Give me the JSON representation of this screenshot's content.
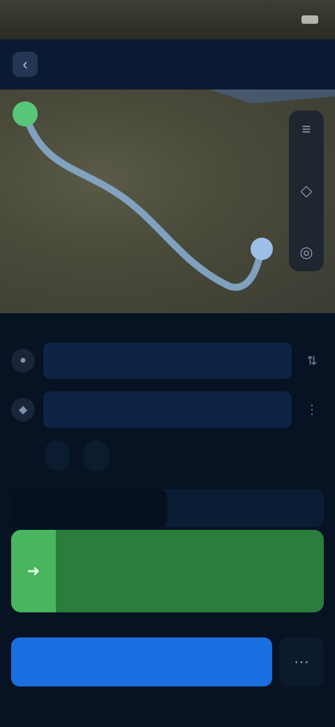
{
  "status_bar": {
    "time": "",
    "battery_icon": "battery-icon"
  },
  "header": {
    "title": "",
    "back_icon": "back-arrow-icon"
  },
  "map": {
    "controls": [
      "layers-icon",
      "compass-icon",
      "locate-icon"
    ]
  },
  "route_inputs": {
    "origin": {
      "value": "",
      "icon": "origin-dot-icon"
    },
    "destination": {
      "value": "",
      "icon": "destination-pin-icon"
    },
    "swap_icon": "swap-icon"
  },
  "options": {
    "chips": [
      "",
      ""
    ]
  },
  "mode_toggle": {
    "options": [
      "",
      ""
    ],
    "active_index": 0
  },
  "route_card": {
    "time": "",
    "details": "",
    "icon": "route-icon"
  },
  "actions": {
    "start_label": "",
    "more_icon": "more-icon"
  },
  "colors": {
    "accent": "#1a6fe0",
    "route_green": "#2a7d3a",
    "route_line": "#8ab0d6",
    "sheet_bg": "#071323"
  }
}
